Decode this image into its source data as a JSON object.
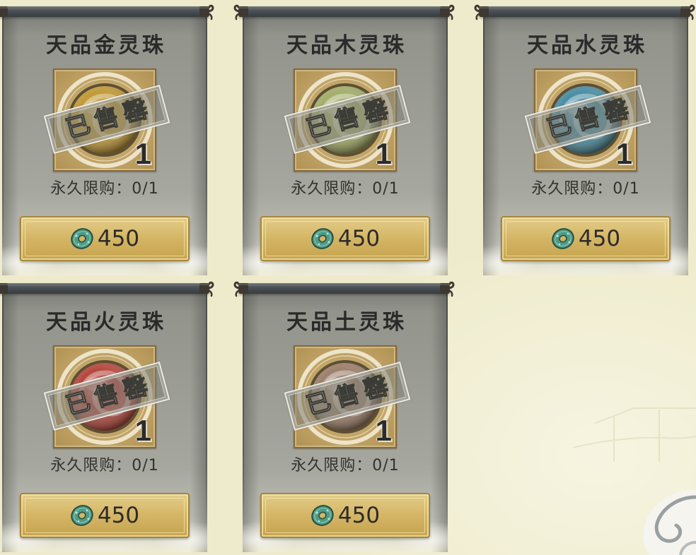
{
  "theme": {
    "background": "#eeebcc",
    "panel": "#9c9d95",
    "button": "#d4b565",
    "text": "#2a2a2a"
  },
  "items": [
    {
      "title": "天品金灵珠",
      "orb_color": "#c19a36",
      "stamp": "已售罄",
      "quantity": "1",
      "limit": "永久限购：0/1",
      "currency_icon": "jade-coin-icon",
      "price": "450"
    },
    {
      "title": "天品木灵珠",
      "orb_color": "#a3ae6a",
      "stamp": "已售罄",
      "quantity": "1",
      "limit": "永久限购：0/1",
      "currency_icon": "jade-coin-icon",
      "price": "450"
    },
    {
      "title": "天品水灵珠",
      "orb_color": "#4a8ea3",
      "stamp": "已售罄",
      "quantity": "1",
      "limit": "永久限购：0/1",
      "currency_icon": "jade-coin-icon",
      "price": "450"
    },
    {
      "title": "天品火灵珠",
      "orb_color": "#b5473e",
      "stamp": "已售罄",
      "quantity": "1",
      "limit": "永久限购：0/1",
      "currency_icon": "jade-coin-icon",
      "price": "450"
    },
    {
      "title": "天品土灵珠",
      "orb_color": "#9c806b",
      "stamp": "已售罄",
      "quantity": "1",
      "limit": "永久限购：0/1",
      "currency_icon": "jade-coin-icon",
      "price": "450"
    }
  ]
}
